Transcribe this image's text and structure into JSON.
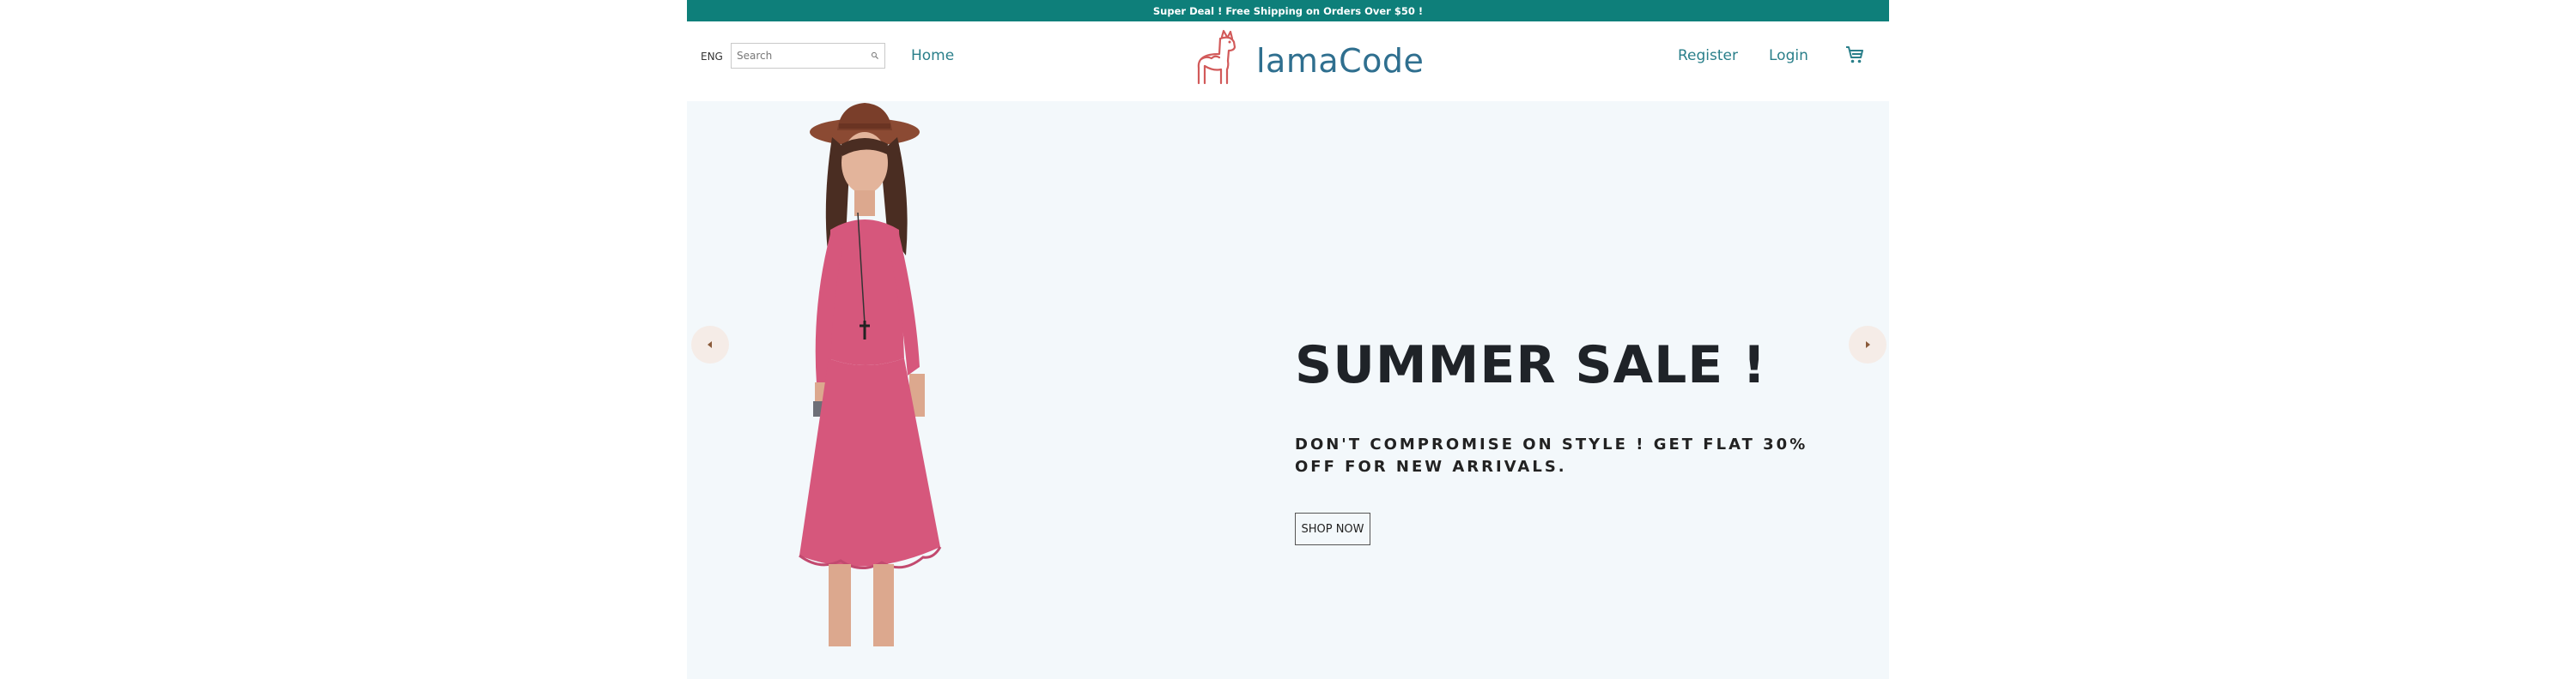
{
  "announcement": {
    "text": "Super Deal ! Free Shipping on Orders Over $50 !"
  },
  "navbar": {
    "language": "ENG",
    "search": {
      "placeholder": "Search",
      "value": ""
    },
    "links": {
      "home": "Home",
      "register": "Register",
      "login": "Login"
    },
    "logo_text": "lamaCode",
    "icons": {
      "search": "search-icon",
      "cart": "shopping-cart-icon",
      "logo": "llama-logo-icon"
    }
  },
  "slider": {
    "title": "SUMMER SALE !",
    "description": "DON'T COMPROMISE ON STYLE ! GET FLAT 30% OFF FOR NEW ARRIVALS.",
    "button": "SHOP NOW",
    "icons": {
      "prev": "arrow-left-icon",
      "next": "arrow-right-icon"
    }
  },
  "colors": {
    "announcement_bg": "#0e7f7a",
    "link": "#2a7f8a",
    "logo_text": "#2f6f8f",
    "slide_bg": "#f3f8fb",
    "dress": "#d6577c"
  }
}
